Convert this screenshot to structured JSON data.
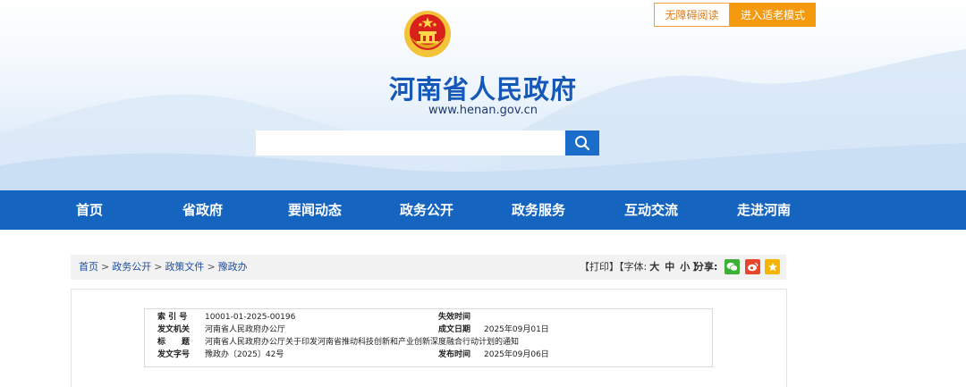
{
  "header": {
    "accessibility_label": "无障碍阅读",
    "elder_mode_label": "进入适老模式",
    "site_title": "河南省人民政府",
    "site_url": "www.henan.gov.cn",
    "search_placeholder": ""
  },
  "nav": {
    "items": [
      "首页",
      "省政府",
      "要闻动态",
      "政务公开",
      "政务服务",
      "互动交流",
      "走进河南"
    ]
  },
  "breadcrumb": {
    "items": [
      "首页",
      "政务公开",
      "政策文件",
      "豫政办"
    ],
    "separator": ">"
  },
  "tools": {
    "print": "【打印】",
    "font_prefix": "【字体:",
    "size_large": "大",
    "size_medium": "中",
    "size_small": "小",
    "font_suffix": "】",
    "share_label": "分享:",
    "share_icons": [
      "wechat-icon",
      "weibo-icon",
      "qzone-icon"
    ]
  },
  "document_meta": {
    "index_label": "索 引 号",
    "index_value": "10001-01-2025-00196",
    "expiry_label": "失效时间",
    "expiry_value": "",
    "issuer_label": "发文机关",
    "issuer_value": "河南省人民政府办公厅",
    "date_written_label": "成文日期",
    "date_written_value": "2025年09月01日",
    "title_label": "标　　题",
    "title_value": "河南省人民政府办公厅关于印发河南省推动科技创新和产业创新深度融合行动计划的通知",
    "doc_number_label": "发文字号",
    "doc_number_value": "豫政办〔2025〕42号",
    "publish_label": "发布时间",
    "publish_value": "2025年09月06日"
  },
  "colors": {
    "nav_blue": "#1565c0",
    "title_blue": "#1658b8",
    "orange": "#f59a0f",
    "wechat_green": "#3cb034",
    "weibo_red": "#e8462c",
    "qzone_yellow": "#f5b400"
  }
}
